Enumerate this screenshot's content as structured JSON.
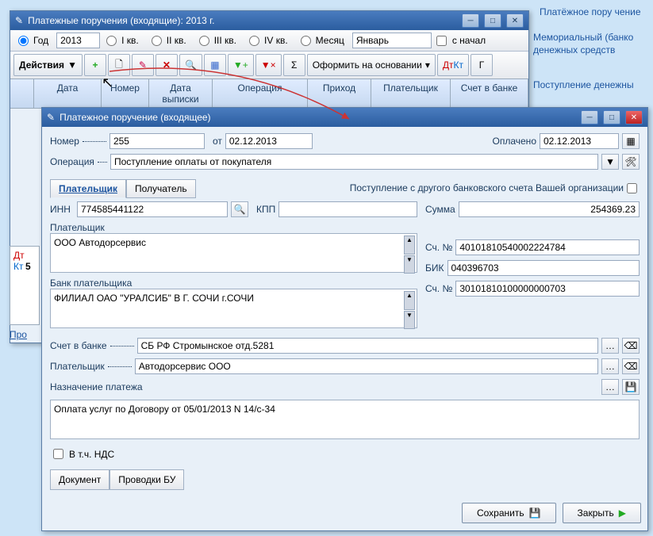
{
  "bg": {
    "txt1": "Платёжное пору чение",
    "txt2": "Мемориальный (банко",
    "txt3": "денежных средств",
    "txt4": "Поступление денежны"
  },
  "w1": {
    "title": "Платежные поручения (входящие): 2013 г.",
    "period": {
      "god": "Год",
      "year": "2013",
      "kv1": "I кв.",
      "kv2": "II кв.",
      "kv3": "III кв.",
      "kv4": "IV кв.",
      "month_label": "Месяц",
      "month_value": "Январь",
      "from_start": "с начал"
    },
    "actions_btn": "Действия",
    "oform": "Оформить на основании",
    "cols": {
      "date": "Дата",
      "number": "Номер",
      "statement_date": "Дата выписки",
      "operation": "Операция",
      "income": "Приход",
      "payer": "Плательщик",
      "bank_acc": "Счет в банке"
    },
    "sidebar": {
      "pro": "Про"
    }
  },
  "w2": {
    "title": "Платежное поручение (входящее)",
    "number_label": "Номер",
    "number_value": "255",
    "from_label": "от",
    "from_date": "02.12.2013",
    "paid_label": "Оплачено",
    "paid_date": "02.12.2013",
    "operation_label": "Операция",
    "operation_value": "Поступление оплаты от покупателя",
    "tabs": {
      "payer": "Плательщик",
      "receiver": "Получатель"
    },
    "transfer_note": "Поступление с другого банковского счета Вашей организации",
    "inn_label": "ИНН",
    "inn_value": "774585441122",
    "kpp_label": "КПП",
    "kpp_value": "",
    "payer_label": "Плательщик",
    "payer_value": "ООО Автодорсервис",
    "bank_label": "Банк плательщика",
    "bank_value": "ФИЛИАЛ ОАО \"УРАЛСИБ\" В Г. СОЧИ г.СОЧИ",
    "sum_label": "Сумма",
    "sum_value": "254369.23",
    "acc1_label": "Сч. №",
    "acc1_value": "40101810540002224784",
    "bik_label": "БИК",
    "bik_value": "040396703",
    "acc2_label": "Сч. №",
    "acc2_value": "30101810100000000703",
    "bankacc_label": "Счет в банке",
    "bankacc_value": "СБ РФ Стромынское отд.5281",
    "payer2_label": "Плательщик",
    "payer2_value": "Автодорсервис ООО",
    "purpose_label": "Назначение платежа",
    "purpose_value": "Оплата услуг по Договору от 05/01/2013 N 14/с-34",
    "vat_label": "В т.ч. НДС",
    "bottom_tabs": {
      "doc": "Документ",
      "entries": "Проводки БУ"
    },
    "save": "Сохранить",
    "close": "Закрыть"
  }
}
